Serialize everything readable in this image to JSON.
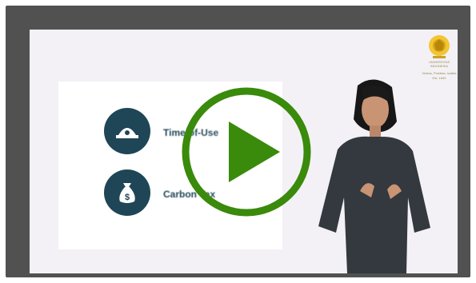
{
  "video": {
    "play_label": "Play video",
    "accent_color": "#3a8a0c"
  },
  "slide": {
    "items": [
      {
        "label": "Time-of-Use",
        "icon": "meter-icon"
      },
      {
        "label": "Carbon Tax",
        "icon": "money-bag-icon"
      }
    ],
    "icon_color": "#1f4657"
  },
  "logo": {
    "name": "UNIVERSITAS INDONESIA",
    "motto": "Veritas, Probitas, Iustitia",
    "est": "Est. 1849",
    "color": "#c9a227"
  }
}
